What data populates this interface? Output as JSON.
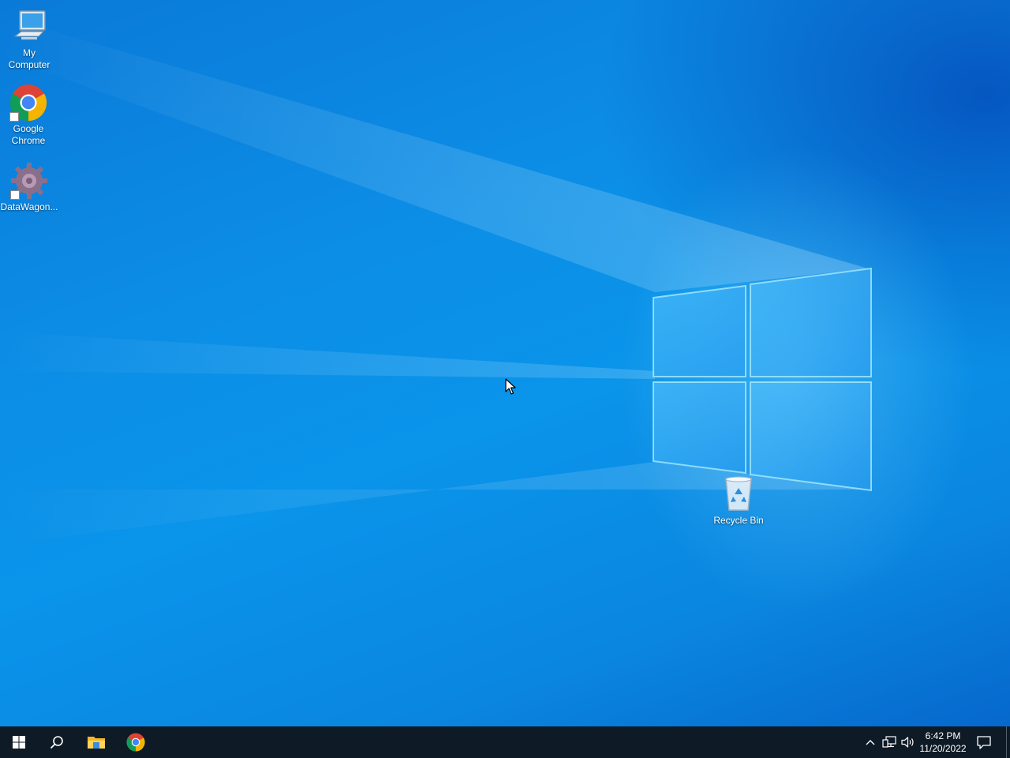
{
  "desktop": {
    "icons": [
      {
        "label_line1": "My",
        "label_line2": "Computer",
        "icon": "my-computer-icon"
      },
      {
        "label_line1": "Google",
        "label_line2": "Chrome",
        "icon": "chrome-icon"
      },
      {
        "label_line1": "DataWagon...",
        "icon": "datawagon-gear-icon"
      },
      {
        "label_line1": "Recycle Bin",
        "icon": "recycle-bin-icon"
      }
    ]
  },
  "taskbar": {
    "start": {
      "icon": "windows-start-icon"
    },
    "search": {
      "icon": "search-icon"
    },
    "pinned": [
      {
        "icon": "file-explorer-icon"
      },
      {
        "icon": "chrome-icon"
      }
    ],
    "tray": {
      "icons": [
        "chevron-up-icon",
        "network-icon",
        "volume-icon"
      ],
      "time": "6:42 PM",
      "date": "11/20/2022",
      "notification_icon": "action-center-icon"
    }
  },
  "colors": {
    "wallpaper": "#0a8ee6",
    "taskbar": "#0e1a26",
    "chrome_red": "#db4437",
    "chrome_yellow": "#f4b400",
    "chrome_green": "#0f9d58",
    "chrome_blue": "#4285f4"
  }
}
